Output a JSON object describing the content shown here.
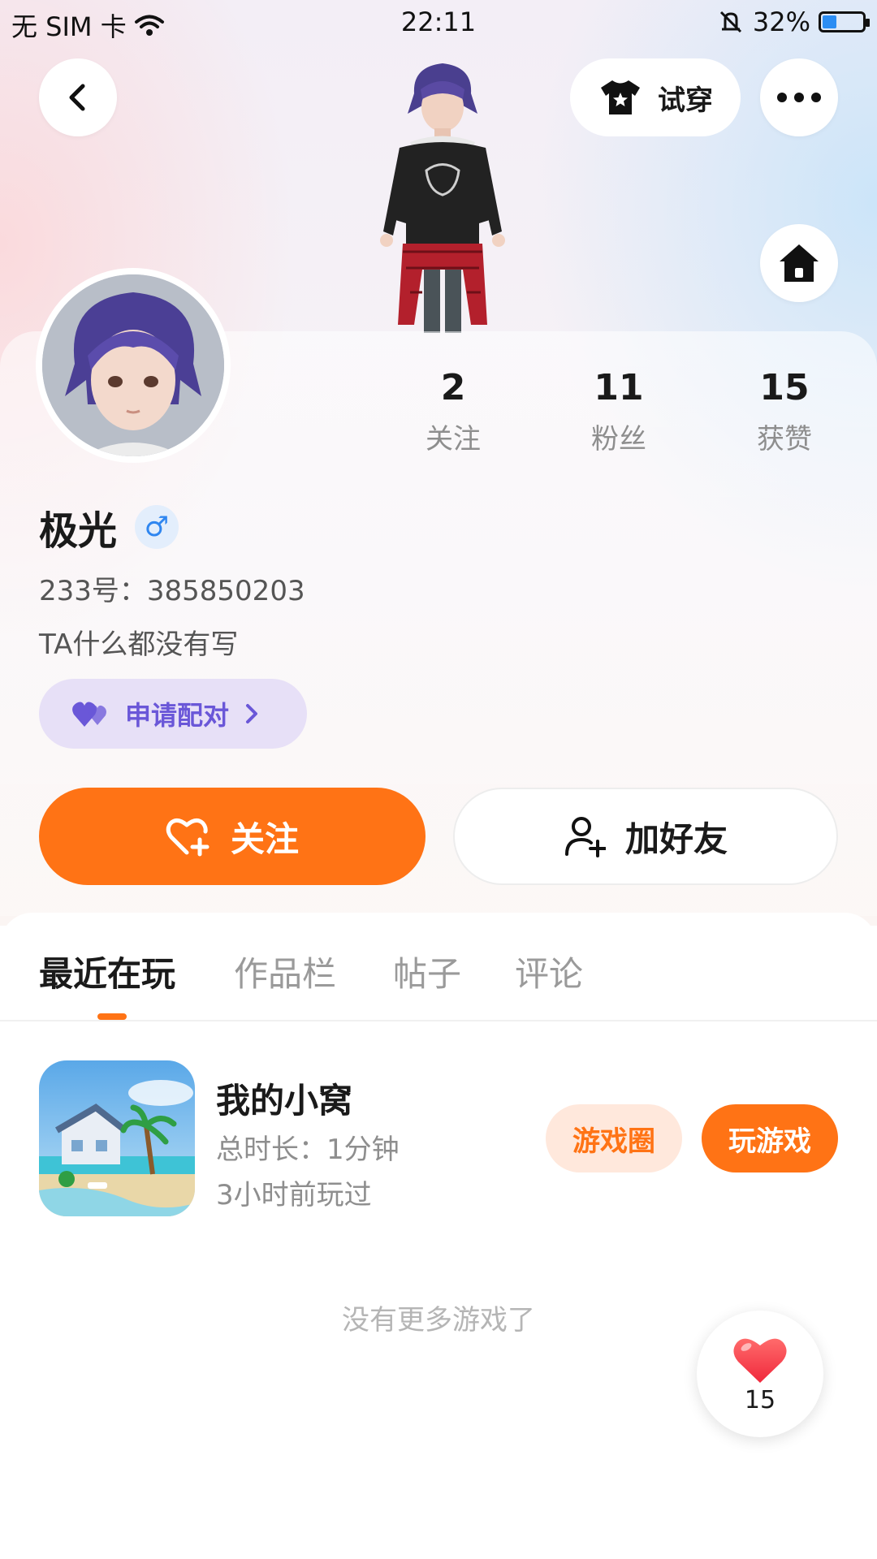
{
  "status_bar": {
    "carrier": "无 SIM 卡",
    "time": "22:11",
    "battery_percent": "32%",
    "battery_level": 0.32
  },
  "header": {
    "tryon_label": "试穿"
  },
  "profile": {
    "name": "极光",
    "gender_symbol": "♂",
    "uid": "233号：385850203",
    "bio": "TA什么都没有写",
    "pair_label": "申请配对",
    "stats": [
      {
        "num": "2",
        "label": "关注"
      },
      {
        "num": "11",
        "label": "粉丝"
      },
      {
        "num": "15",
        "label": "获赞"
      }
    ],
    "follow_label": "关注",
    "add_friend_label": "加好友"
  },
  "tabs": [
    {
      "label": "最近在玩",
      "active": true
    },
    {
      "label": "作品栏",
      "active": false
    },
    {
      "label": "帖子",
      "active": false
    },
    {
      "label": "评论",
      "active": false
    }
  ],
  "games": [
    {
      "title": "我的小窝",
      "duration": "总时长：1分钟",
      "last_played": "3小时前玩过",
      "circle_label": "游戏圈",
      "play_label": "玩游戏"
    }
  ],
  "no_more_text": "没有更多游戏了",
  "like_fab": {
    "count": "15"
  },
  "colors": {
    "accent": "#ff7315",
    "pair_purple": "#6a57d8",
    "gender_blue": "#2f86f0"
  }
}
